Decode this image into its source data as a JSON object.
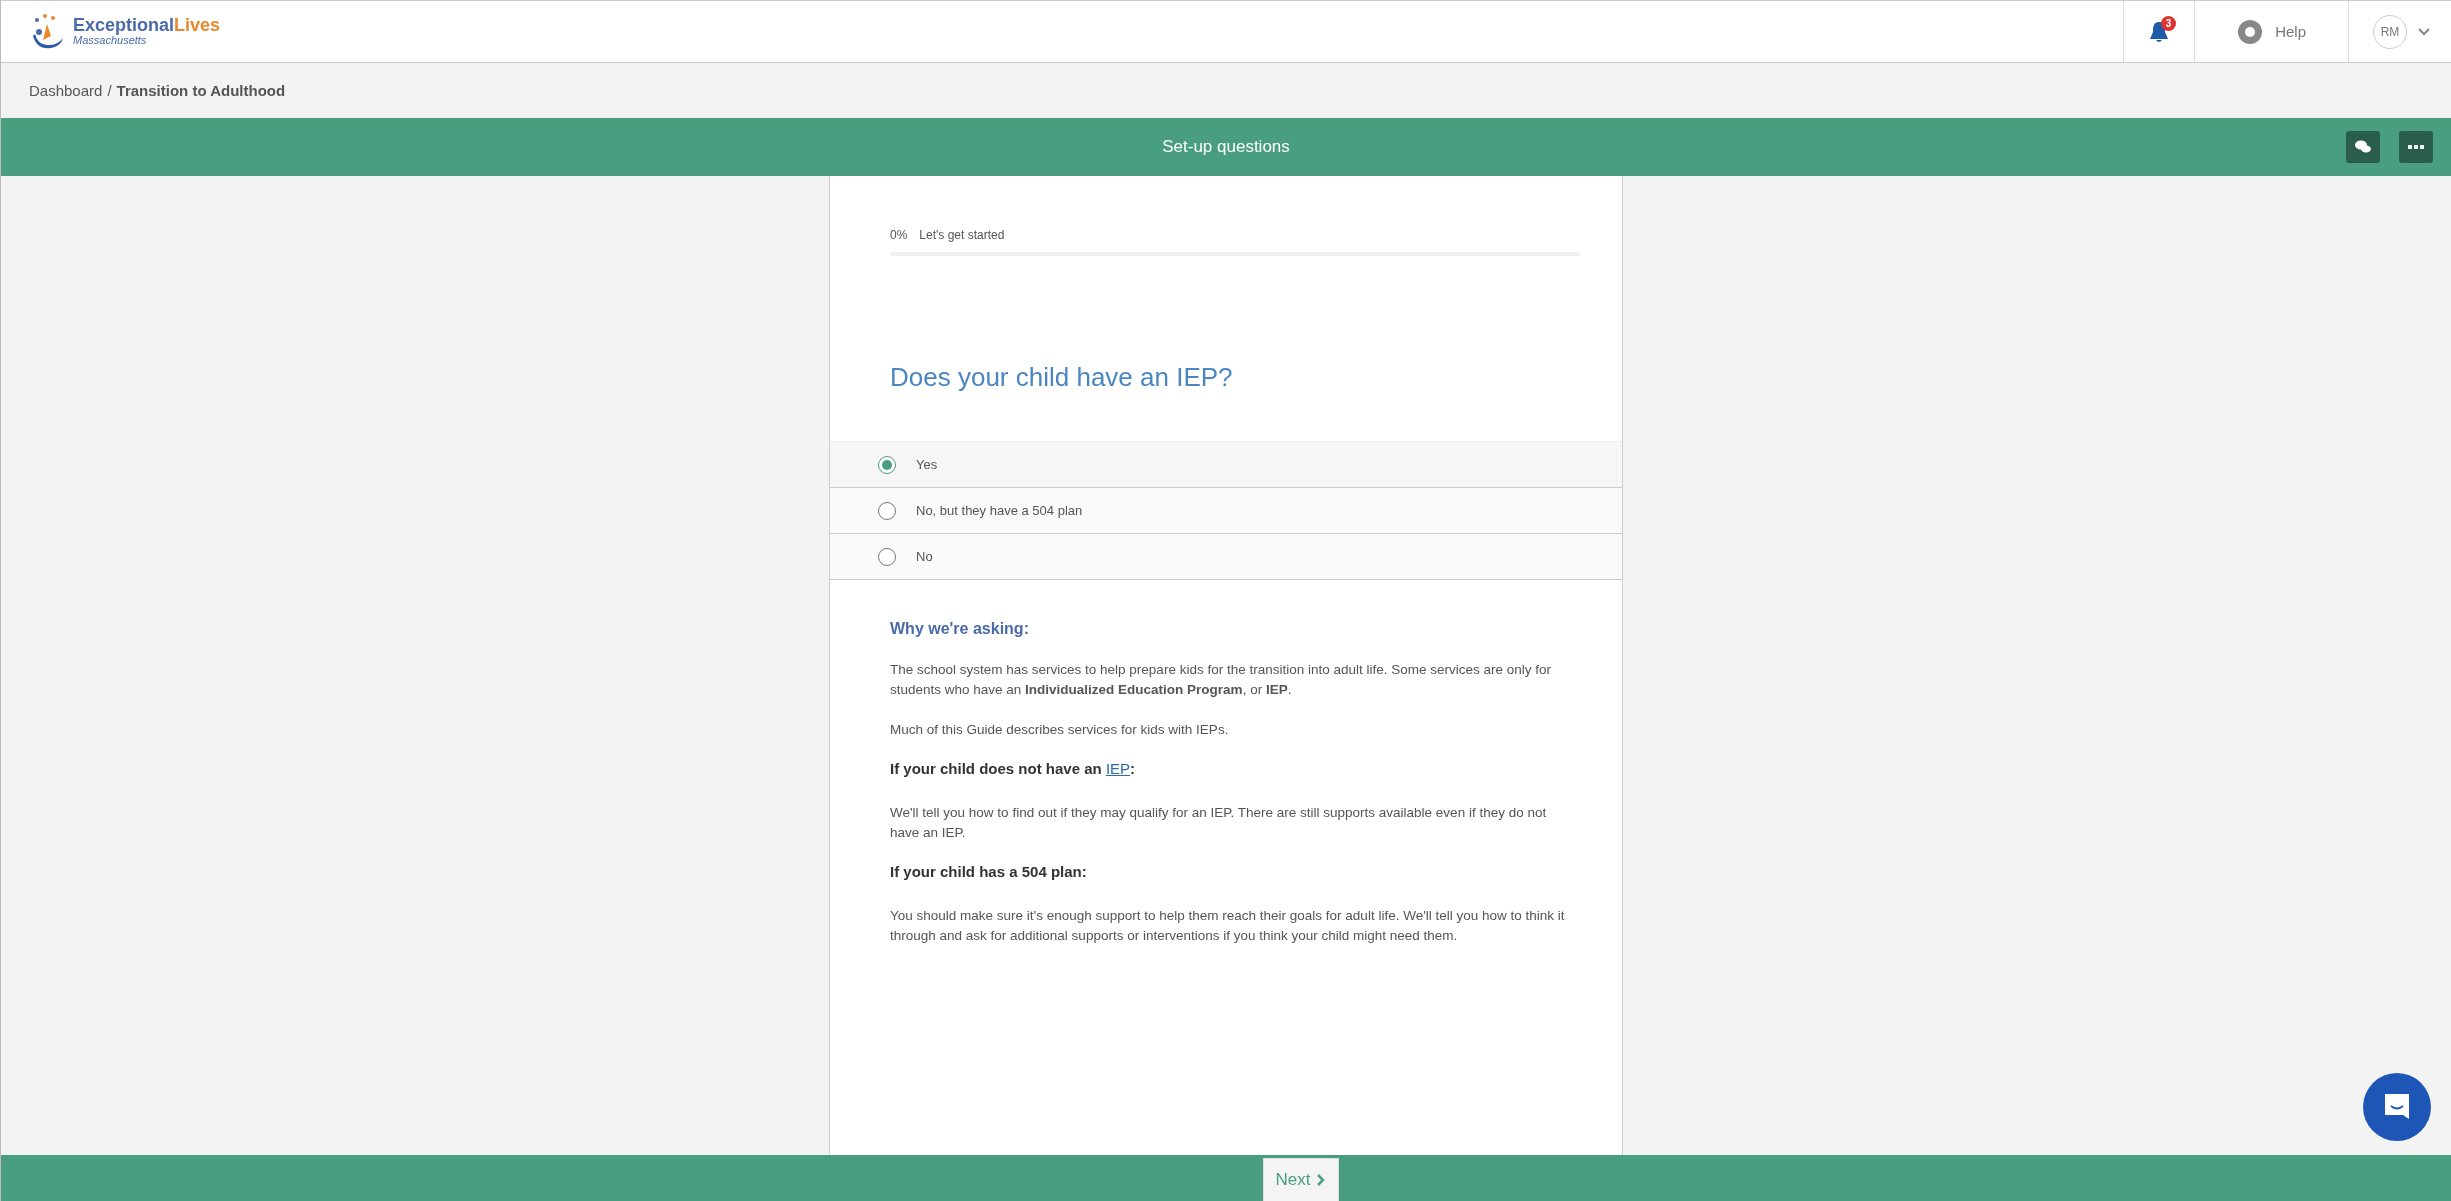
{
  "header": {
    "logo": {
      "primary": "Exceptional",
      "secondary": "Lives",
      "region": "Massachusetts"
    },
    "notifications": {
      "count": "3"
    },
    "help": "Help",
    "user": {
      "initials": "RM"
    }
  },
  "breadcrumb": {
    "items": [
      "Dashboard",
      "Transition to Adulthood"
    ],
    "separator": "/"
  },
  "title_bar": {
    "title": "Set-up questions"
  },
  "progress": {
    "percent": "0%",
    "label": "Let's get started",
    "level": 0
  },
  "question": {
    "text": "Does your child have an IEP?",
    "options": [
      {
        "label": "Yes",
        "selected": true
      },
      {
        "label": "No, but they have a 504 plan",
        "selected": false
      },
      {
        "label": "No",
        "selected": false
      }
    ]
  },
  "explanation": {
    "heading": "Why we're asking:",
    "paragraphs": [
      "The school system has services to help prepare kids for the transition into adult life.  Some services are only for students who have an **Individualized Education Program**, or **IEP**.",
      "Much of this Guide describes services for kids with IEPs."
    ],
    "sections": [
      {
        "heading": "If your child does not have an ",
        "link": "IEP",
        "suffix": ":",
        "text": "We'll tell you how to find out if they may qualify for an IEP. There are still supports available even if they do not have an IEP."
      },
      {
        "heading": "If your child has a 504 plan:",
        "text": "You should make sure it's enough support to help them reach their goals for adult life.  We'll tell you how to think it through and ask for additional supports or interventions if you think your child might need them."
      }
    ]
  },
  "footer": {
    "next": "Next"
  }
}
